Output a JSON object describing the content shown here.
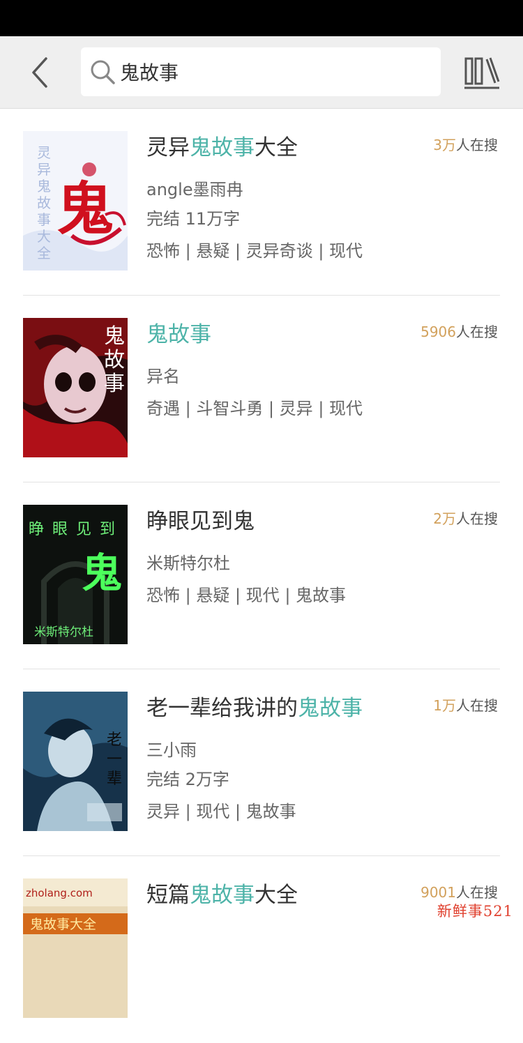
{
  "search": {
    "value": "鬼故事"
  },
  "results": [
    {
      "title": {
        "before": "灵异",
        "highlight": "鬼故事",
        "after": "大全"
      },
      "hot": {
        "number": "3万",
        "suffix": "人在搜"
      },
      "author": "angle墨雨冉",
      "status": "完结  11万字",
      "tags": "恐怖 | 悬疑 | 灵异奇谈 | 现代",
      "cover_text": [
        "灵",
        "异",
        "鬼",
        "故",
        "事",
        "大",
        "全"
      ],
      "cover_big": "鬼"
    },
    {
      "title": {
        "before": "",
        "highlight": "鬼故事",
        "after": ""
      },
      "hot": {
        "number": "5906",
        "suffix": "人在搜"
      },
      "author": "异名",
      "status": "",
      "tags": "奇遇 | 斗智斗勇 | 灵异 | 现代",
      "cover_text": [
        "鬼",
        "故",
        "事"
      ]
    },
    {
      "title": {
        "before": "睁眼见到鬼",
        "highlight": "",
        "after": ""
      },
      "hot": {
        "number": "2万",
        "suffix": "人在搜"
      },
      "author": "米斯特尔杜",
      "status": "",
      "tags": "恐怖 | 悬疑 | 现代 | 鬼故事",
      "cover_text": [
        "睁",
        "眼",
        "见",
        "到"
      ],
      "cover_big": "鬼",
      "cover_sub": "米斯特尔杜"
    },
    {
      "title": {
        "before": "老一辈给我讲的",
        "highlight": "鬼故事",
        "after": ""
      },
      "hot": {
        "number": "1万",
        "suffix": "人在搜"
      },
      "author": "三小雨",
      "status": "完结  2万字",
      "tags": "灵异 | 现代 | 鬼故事",
      "cover_text": [
        "老",
        "一",
        "辈"
      ]
    },
    {
      "title": {
        "before": "短篇",
        "highlight": "鬼故事",
        "after": "大全"
      },
      "hot": {
        "number": "9001",
        "suffix": "人在搜"
      },
      "author": "",
      "status": "",
      "tags": "",
      "cover_text": [
        "zholang.com",
        "鬼故事大全"
      ]
    }
  ],
  "watermark": "新鲜事521",
  "colors": {
    "highlight": "#4db3a8",
    "hot_number": "#d2a15c",
    "header_bg": "#efefef"
  }
}
